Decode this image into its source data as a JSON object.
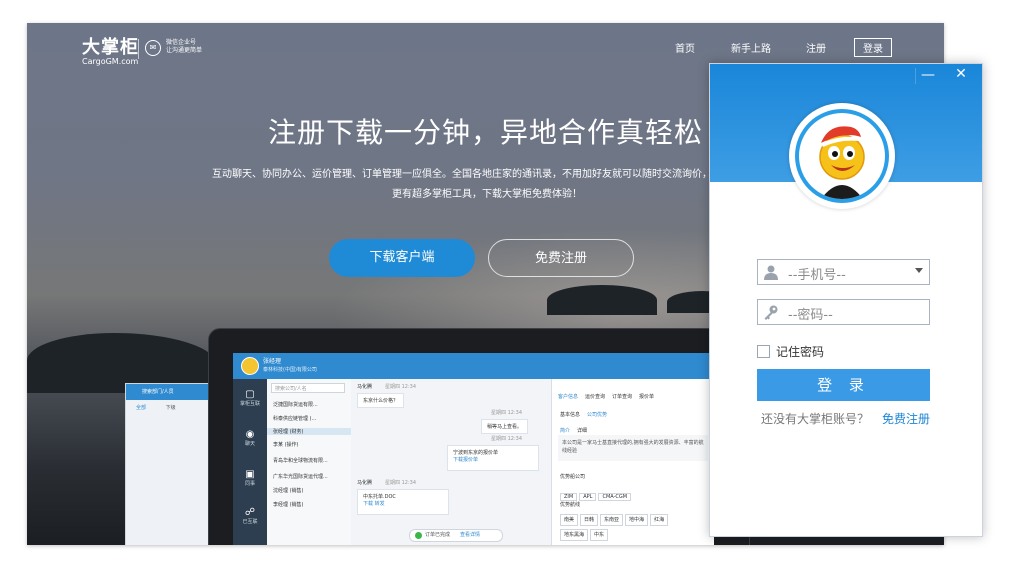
{
  "site": {
    "logo_cn": "大掌柜",
    "logo_en": "CargoGM.com",
    "wechat_line1": "微信企业号",
    "wechat_line2": "让沟通更简单",
    "nav": [
      {
        "label": "首页"
      },
      {
        "label": "新手上路"
      },
      {
        "label": "注册"
      },
      {
        "label": "登录"
      }
    ],
    "hero_title": "注册下载一分钟，异地合作真轻松",
    "hero_sub1": "互动聊天、协同办公、运价管理、订单管理一应俱全。全国各地庄家的通讯录，不用加好友就可以随时交流询价，更可以随时",
    "hero_sub2": "更有超多掌柜工具，下载大掌柜免费体验！",
    "btn_download": "下载客户端",
    "btn_register": "免费注册"
  },
  "app_mock": {
    "user_name": "张经理",
    "user_company": "泰林科技(中国)有限公司",
    "search_placeholder": "搜索公司/人名",
    "sidebar": [
      {
        "icon": "▢",
        "label": "掌柜互联"
      },
      {
        "icon": "◉",
        "label": "聊天"
      },
      {
        "icon": "▣",
        "label": "同事"
      },
      {
        "icon": "☍",
        "label": "已互联"
      }
    ],
    "contacts": [
      {
        "label": "泛捷国际货运有限..."
      },
      {
        "label": "科泰供应链管理 (..."
      },
      {
        "label": "张经理 (财务)"
      },
      {
        "label": "李某 (操作)"
      },
      {
        "label": "青岛华和全球物流有限..."
      },
      {
        "label": "广东华光国际货运代理..."
      },
      {
        "label": "沈经理 (销售)"
      },
      {
        "label": "李经理 (销售)"
      }
    ],
    "chat": [
      {
        "who": "马化腾",
        "time": "星期四 12:34",
        "text": "东京什么价格？"
      },
      {
        "who": "",
        "time": "星期四 12:34",
        "text": "稍等马上查看。"
      },
      {
        "who": "",
        "time": "星期四 12:34",
        "text": "宁波到东京的报价单"
      },
      {
        "who": "",
        "time": "",
        "text": "下载报价单"
      },
      {
        "who": "马化腾",
        "time": "星期四 12:34",
        "text": "中东托单.DOC"
      },
      {
        "who": "",
        "time": "",
        "text": "下载  转发"
      }
    ],
    "order_done": "订单已完成",
    "order_view": "查看详情",
    "info_tabs": [
      "客户信息",
      "运价查询",
      "订单查询",
      "报价单"
    ],
    "info_sub": [
      "基本信息",
      "公司优势"
    ],
    "info_sub2": [
      "简介",
      "详细"
    ],
    "info_text": "本公司是一家马士基直接代理的,拥有强大的发展资源、丰富的航线经验",
    "advantage_title": "优势船公司",
    "carriers": [
      "ZIM",
      "APL",
      "CMA-CGM"
    ],
    "route_title": "优势航线",
    "routes": [
      "南美",
      "日韩",
      "东南亚",
      "地中海",
      "红海",
      "地东黑海",
      "中东"
    ],
    "panel_left_search": "搜索部门/人员",
    "panel_left_tabs": [
      "全部",
      "下级"
    ]
  },
  "login": {
    "min": "—",
    "close": "✕",
    "phone_placeholder": "--手机号--",
    "password_placeholder": "--密码--",
    "remember": "记住密码",
    "submit": "登 录",
    "no_account": "还没有大掌柜账号？",
    "free_register": "免费注册"
  }
}
